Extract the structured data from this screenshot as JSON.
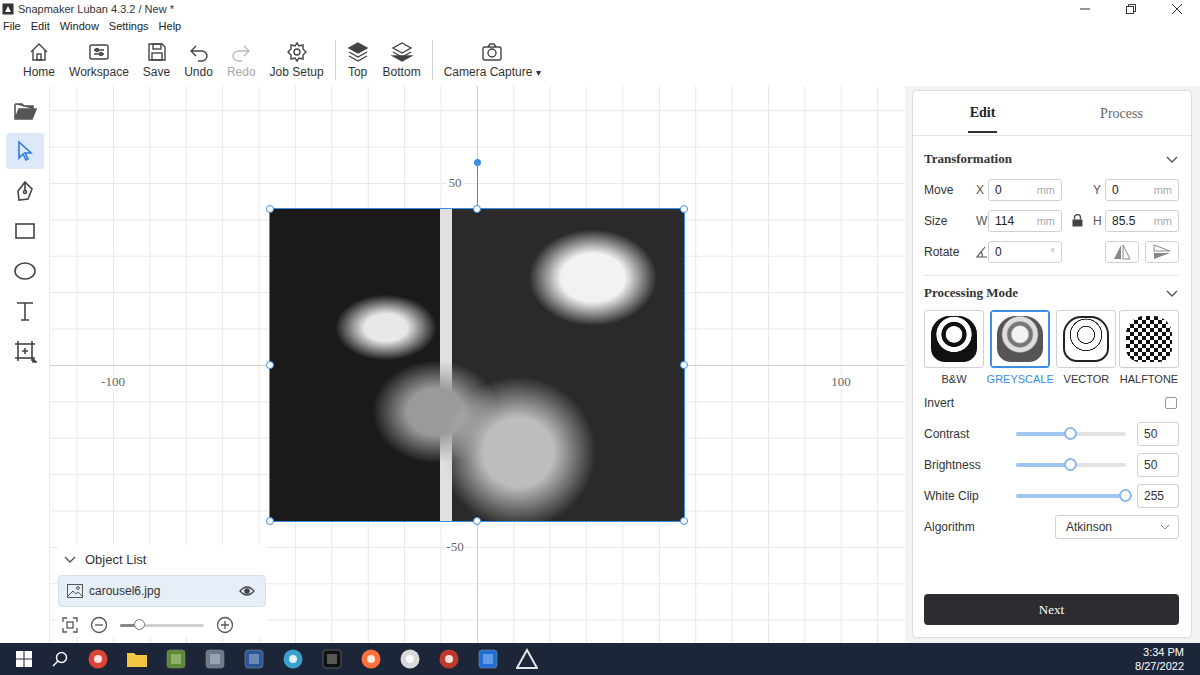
{
  "window": {
    "title": "Snapmaker Luban 4.3.2 / New *"
  },
  "menu": [
    {
      "label": "File"
    },
    {
      "label": "Edit"
    },
    {
      "label": "Window"
    },
    {
      "label": "Settings"
    },
    {
      "label": "Help"
    }
  ],
  "toolbar": [
    [
      {
        "label": "Home",
        "kind": "home",
        "disabled": false
      },
      {
        "label": "Workspace",
        "kind": "workspace",
        "disabled": false
      },
      {
        "label": "Save",
        "kind": "save",
        "disabled": false
      },
      {
        "label": "Undo",
        "kind": "undo",
        "disabled": false
      },
      {
        "label": "Redo",
        "kind": "redo",
        "disabled": true
      },
      {
        "label": "Job Setup",
        "kind": "gear",
        "disabled": false
      }
    ],
    [
      {
        "label": "Top",
        "kind": "top",
        "disabled": false
      },
      {
        "label": "Bottom",
        "kind": "bottom",
        "disabled": false
      }
    ],
    [
      {
        "label": "Camera Capture",
        "kind": "camera",
        "disabled": false,
        "arrow": "▾"
      }
    ]
  ],
  "tools": [
    {
      "kind": "open",
      "selected": false
    },
    {
      "kind": "select",
      "selected": true
    },
    {
      "kind": "pen",
      "selected": false
    },
    {
      "kind": "rect",
      "selected": false
    },
    {
      "kind": "ellipse",
      "selected": false
    },
    {
      "kind": "text",
      "selected": false
    },
    {
      "kind": "shape",
      "selected": false
    }
  ],
  "canvas": {
    "axis_labels": [
      {
        "text": "50",
        "axis": "y"
      },
      {
        "text": "-100",
        "axis": "x"
      },
      {
        "text": "100",
        "axis": "x"
      },
      {
        "text": "-50",
        "axis": "y"
      }
    ],
    "image": {
      "selected": true
    }
  },
  "object_list": {
    "title": "Object List",
    "expanded": true,
    "items": [
      {
        "name": "carousel6.jpg",
        "visible": true,
        "selected": true
      }
    ],
    "zoom": {
      "level": 0.24
    }
  },
  "panel": {
    "tabs": [
      {
        "label": "Edit",
        "selected": true
      },
      {
        "label": "Process",
        "selected": false
      }
    ],
    "transformation": {
      "title": "Transformation",
      "expanded": true,
      "move": {
        "label": "Move",
        "x": {
          "axis": "X",
          "value": "0",
          "unit": "mm"
        },
        "y": {
          "axis": "Y",
          "value": "0",
          "unit": "mm"
        }
      },
      "size": {
        "label": "Size",
        "w": {
          "axis": "W",
          "value": "114",
          "unit": "mm"
        },
        "h": {
          "axis": "H",
          "value": "85.5",
          "unit": "mm"
        },
        "locked": true
      },
      "rotate": {
        "label": "Rotate",
        "value": "0",
        "unit": "°"
      }
    },
    "processing": {
      "title": "Processing Mode",
      "expanded": true,
      "modes": [
        {
          "label": "B&W",
          "selected": false
        },
        {
          "label": "GREYSCALE",
          "selected": true
        },
        {
          "label": "VECTOR",
          "selected": false
        },
        {
          "label": "HALFTONE",
          "selected": false
        }
      ],
      "invert": {
        "label": "Invert",
        "checked": false
      },
      "sliders": [
        {
          "label": "Contrast",
          "value": "50",
          "level": 0.5
        },
        {
          "label": "Brightness",
          "value": "50",
          "level": 0.5
        },
        {
          "label": "White Clip",
          "value": "255",
          "level": 1
        }
      ],
      "algorithm": {
        "label": "Algorithm",
        "value": "Atkinson"
      }
    },
    "next": "Next"
  },
  "taskbar": {
    "apps": [
      {
        "kind": "circle",
        "color": "#db4437"
      },
      {
        "kind": "folder",
        "color": "#f4c542"
      },
      {
        "kind": "square",
        "color": "#5b8c32"
      },
      {
        "kind": "square",
        "color": "#6b7b8c"
      },
      {
        "kind": "square",
        "color": "#2b579a"
      },
      {
        "kind": "circle",
        "color": "#3aa0d0"
      },
      {
        "kind": "square",
        "color": "#111111"
      },
      {
        "kind": "circle",
        "color": "#ff7139"
      },
      {
        "kind": "circle",
        "color": "#d9d9d9"
      },
      {
        "kind": "circle",
        "color": "#c0392b"
      },
      {
        "kind": "square",
        "color": "#1e6fd9"
      },
      {
        "kind": "triangle",
        "color": "#e6e6e6"
      }
    ],
    "time": "3:34 PM",
    "date": "8/27/2022"
  }
}
